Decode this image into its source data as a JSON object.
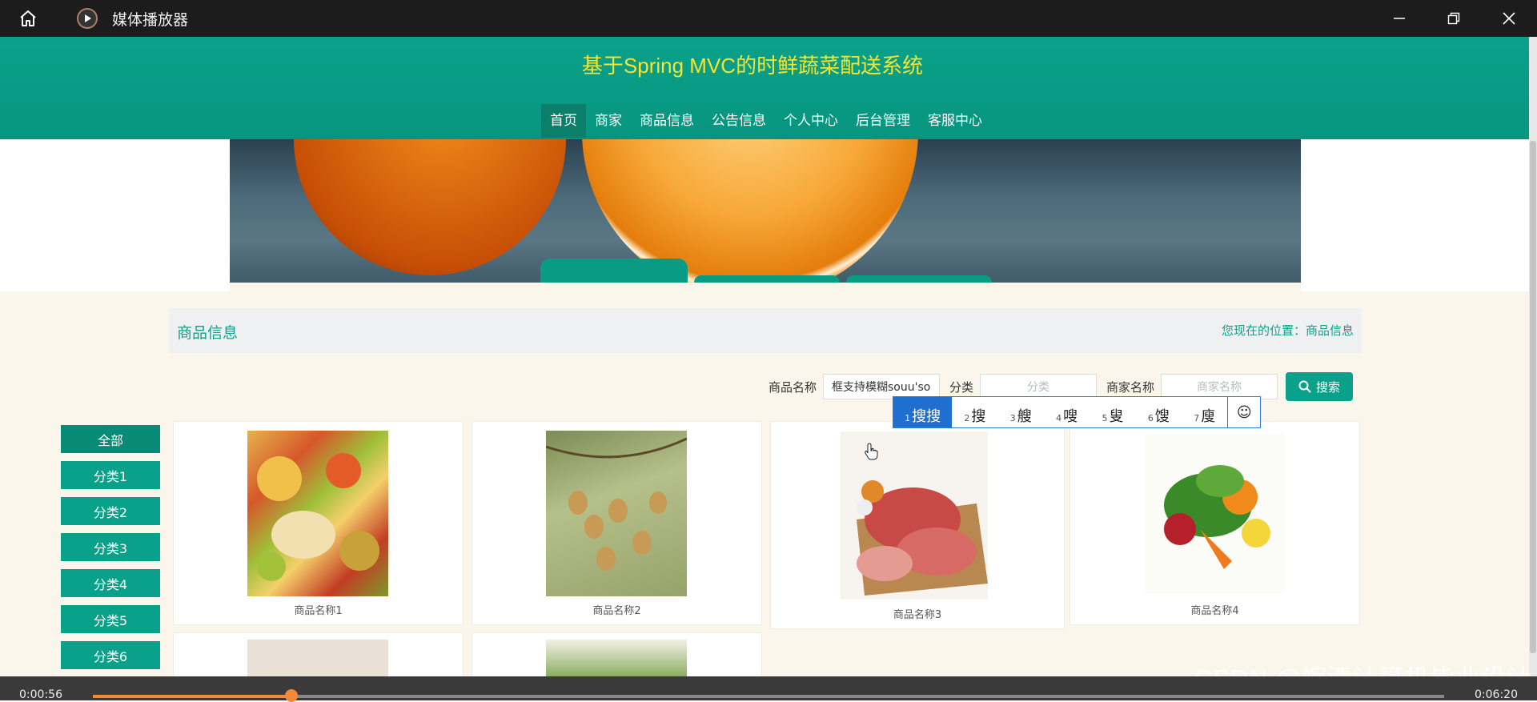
{
  "window": {
    "title": "媒体播放器"
  },
  "site": {
    "title": "基于Spring MVC的时鲜蔬菜配送系统"
  },
  "nav": [
    {
      "label": "首页",
      "active": true
    },
    {
      "label": "商家"
    },
    {
      "label": "商品信息"
    },
    {
      "label": "公告信息"
    },
    {
      "label": "个人中心"
    },
    {
      "label": "后台管理"
    },
    {
      "label": "客服中心"
    }
  ],
  "breadcrumb": {
    "title": "商品信息",
    "location": "您现在的位置：商品信息"
  },
  "search": {
    "name_label": "商品名称",
    "name_value": "框支持模糊souu'so",
    "category_label": "分类",
    "category_placeholder": "分类",
    "merchant_label": "商家名称",
    "merchant_placeholder": "商家名称",
    "button_label": "搜索"
  },
  "ime": {
    "candidates": [
      {
        "num": "1",
        "text": "搜搜"
      },
      {
        "num": "2",
        "text": "搜"
      },
      {
        "num": "3",
        "text": "艘"
      },
      {
        "num": "4",
        "text": "嗖"
      },
      {
        "num": "5",
        "text": "叟"
      },
      {
        "num": "6",
        "text": "馊"
      },
      {
        "num": "7",
        "text": "廋"
      }
    ],
    "emoji": "☺"
  },
  "categories": [
    "全部",
    "分类1",
    "分类2",
    "分类3",
    "分类4",
    "分类5",
    "分类6"
  ],
  "products": [
    {
      "name": "商品名称1",
      "image": "fruit-platter"
    },
    {
      "name": "商品名称2",
      "image": "fruit-tree"
    },
    {
      "name": "商品名称3",
      "image": "raw-meat"
    },
    {
      "name": "商品名称4",
      "image": "vegetables"
    }
  ],
  "player": {
    "current_time": "0:00:56",
    "total_time": "0:06:20",
    "progress": 0.147
  },
  "watermark": "CSDN @婉清计算机毕业设计",
  "colors": {
    "brand": "#0aa18a",
    "title_yellow": "#f5e430",
    "progress": "#f08a38"
  }
}
